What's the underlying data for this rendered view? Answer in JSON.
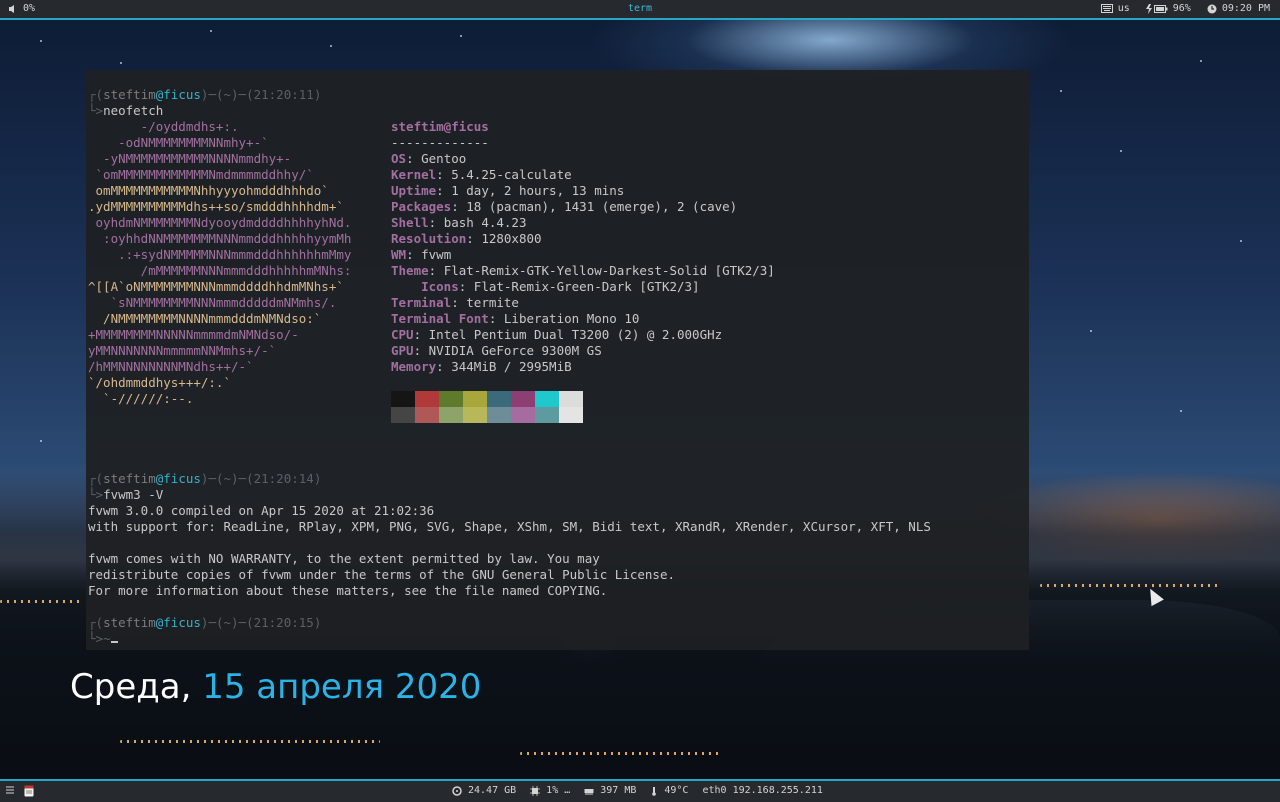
{
  "topbar": {
    "volume_icon": "volume-icon",
    "volume": "0%",
    "window_title": "term",
    "keyboard_icon": "keyboard-icon",
    "layout": "us",
    "battery_icon": "battery-charging-icon",
    "battery": "96%",
    "clock_icon": "clock-icon",
    "time": "09:20 PM"
  },
  "terminal": {
    "prompts": [
      {
        "user": "steftim",
        "at": "@",
        "host": "ficus",
        "sep1": ")─(",
        "dir": "~",
        "sep2": ")─(",
        "time": "21:20:11",
        "command": "neofetch"
      },
      {
        "user": "steftim",
        "at": "@",
        "host": "ficus",
        "sep1": ")─(",
        "dir": "~",
        "sep2": ")─(",
        "time": "21:20:14",
        "command": "fvwm3 -V"
      },
      {
        "user": "steftim",
        "at": "@",
        "host": "ficus",
        "sep1": ")─(",
        "dir": "~",
        "sep2": ")─(",
        "time": "21:20:15",
        "command": "~"
      }
    ],
    "logo_lines": [
      "       -/oyddmdhs+:.",
      "    -odNMMMMMMMMNNmhy+-`",
      "  -yNMMMMMMMMMMMNNNNmmdhy+-",
      " `omMMMMMMMMMMMMNmdmmmmddhhy/`",
      " omMMMMMMMMMMMNhhyyyohmdddhhhdo`",
      ".ydMMMMMMMMMMdhs++so/smdddhhhhdm+`",
      " oyhdmNMMMMMMMNdyooydmddddhhhhyhNd.",
      "  :oyhhdNNMMMMMMMNNNmmdddhhhhhyymMh",
      "    .:+sydNMMMMMNNNmmmdddhhhhhhmMmy",
      "       /mMMMMMMNNNmmmdddhhhhhmMNhs:",
      "^[[A`oNMMMMMMMNNNmmmddddhhdmMNhs+`",
      "   `sNMMMMMMMMNNNmmmdddddmNMmhs/.",
      "  /NMMMMMMMMNNNNmmmdddmNMNdso:`",
      "+MMMMMMMMNNNNNmmmmdmNMNdso/-",
      "yMMNNNNNNNmmmmmNNMmhs+/-`",
      "/hMMNNNNNNNNMNdhs++/-`",
      "`/ohdmmddhys+++/:.`",
      "  `-//////:--."
    ],
    "info_header": "steftim@ficus",
    "info_rule": "-------------",
    "info": [
      {
        "key": "OS",
        "value": "Gentoo"
      },
      {
        "key": "Kernel",
        "value": "5.4.25-calculate"
      },
      {
        "key": "Uptime",
        "value": "1 day, 2 hours, 13 mins"
      },
      {
        "key": "Packages",
        "value": "18 (pacman), 1431 (emerge), 2 (cave)"
      },
      {
        "key": "Shell",
        "value": "bash 4.4.23"
      },
      {
        "key": "Resolution",
        "value": "1280x800"
      },
      {
        "key": "WM",
        "value": "fvwm"
      },
      {
        "key": "Theme",
        "value": "Flat-Remix-GTK-Yellow-Darkest-Solid [GTK2/3]"
      },
      {
        "key": "    Icons",
        "value": "Flat-Remix-Green-Dark [GTK2/3]"
      },
      {
        "key": "Terminal",
        "value": "termite"
      },
      {
        "key": "Terminal Font",
        "value": "Liberation Mono 10"
      },
      {
        "key": "CPU",
        "value": "Intel Pentium Dual T3200 (2) @ 2.000GHz"
      },
      {
        "key": "GPU",
        "value": "NVIDIA GeForce 9300M GS"
      },
      {
        "key": "Memory",
        "value": "344MiB / 2995MiB"
      }
    ],
    "palette_top": [
      "#151515",
      "#b03a3a",
      "#5e7a2b",
      "#a7a73c",
      "#3a6a7c",
      "#8d3e72",
      "#1ec8cc",
      "#dcdcdc"
    ],
    "palette_bottom": [
      "#454545",
      "#b05858",
      "#8ea36a",
      "#b6b85a",
      "#6d8d99",
      "#a66ba0",
      "#5e9ba0",
      "#e4e4e4"
    ],
    "fvwm_output": [
      "fvwm 3.0.0 compiled on Apr 15 2020 at 21:02:36",
      "with support for: ReadLine, RPlay, XPM, PNG, SVG, Shape, XShm, SM, Bidi text, XRandR, XRender, XCursor, XFT, NLS",
      "",
      "fvwm comes with NO WARRANTY, to the extent permitted by law. You may",
      "redistribute copies of fvwm under the terms of the GNU General Public License.",
      "For more information about these matters, see the file named COPYING."
    ]
  },
  "desktop_date": {
    "weekday": "Среда,",
    "date": "15 апреля 2020"
  },
  "bottombar": {
    "menu_icon": "terminal-menu-icon",
    "disk_icon": "disk-icon",
    "disk": "24.47 GB",
    "cpu_icon": "cpu-icon",
    "cpu": "1%",
    "cpu_extra": "…",
    "mem_icon": "memory-icon",
    "mem": "397 MB",
    "temp_icon": "thermometer-icon",
    "temp": "49°C",
    "net": "eth0 192.168.255.211"
  },
  "colors": {
    "accent": "#25a8c5",
    "bar": "#26292e",
    "logo": "#a36fa0",
    "host": "#35b3c6",
    "date_highlight": "#2bb3e6"
  }
}
